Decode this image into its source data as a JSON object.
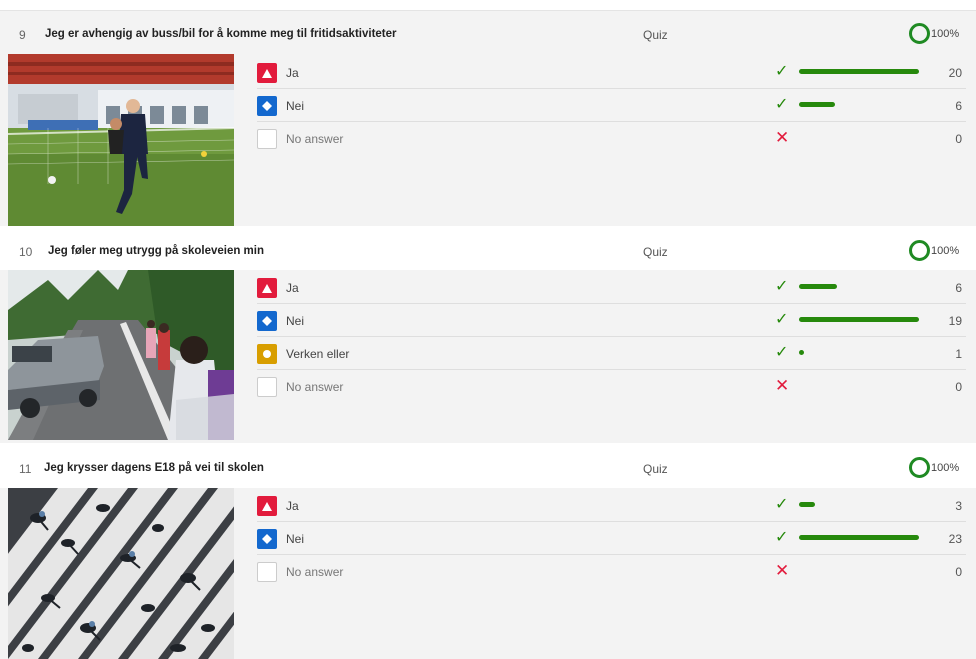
{
  "questions": [
    {
      "number": "9",
      "title": "Jeg er avhengig av buss/bil for å komme meg til fritidsaktiviteter",
      "type": "Quiz",
      "percent": "100%",
      "max": 20,
      "answers": [
        {
          "label": "Ja",
          "shape": "triangle",
          "color": "#e21b3c",
          "correct": true,
          "count": "20",
          "value": 20
        },
        {
          "label": "Nei",
          "shape": "diamond",
          "color": "#1368ce",
          "correct": true,
          "count": "6",
          "value": 6
        },
        {
          "label": "No answer",
          "shape": "none",
          "color": "#ffffff",
          "correct": false,
          "count": "0",
          "value": 0
        }
      ]
    },
    {
      "number": "10",
      "title": "Jeg føler meg utrygg på skoleveien min",
      "type": "Quiz",
      "percent": "100%",
      "max": 19,
      "answers": [
        {
          "label": "Ja",
          "shape": "triangle",
          "color": "#e21b3c",
          "correct": true,
          "count": "6",
          "value": 6
        },
        {
          "label": "Nei",
          "shape": "diamond",
          "color": "#1368ce",
          "correct": true,
          "count": "19",
          "value": 19
        },
        {
          "label": "Verken eller",
          "shape": "circle",
          "color": "#d89e00",
          "correct": true,
          "count": "1",
          "value": 1
        },
        {
          "label": "No answer",
          "shape": "none",
          "color": "#ffffff",
          "correct": false,
          "count": "0",
          "value": 0
        }
      ]
    },
    {
      "number": "11",
      "title": "Jeg krysser dagens E18 på vei til skolen",
      "type": "Quiz",
      "percent": "100%",
      "max": 23,
      "answers": [
        {
          "label": "Ja",
          "shape": "triangle",
          "color": "#e21b3c",
          "correct": true,
          "count": "3",
          "value": 3
        },
        {
          "label": "Nei",
          "shape": "diamond",
          "color": "#1368ce",
          "correct": true,
          "count": "23",
          "value": 23
        },
        {
          "label": "No answer",
          "shape": "none",
          "color": "#ffffff",
          "correct": false,
          "count": "0",
          "value": 0
        }
      ]
    }
  ],
  "icons": {
    "correct": "checkmark-icon",
    "incorrect": "cross-icon",
    "progress": "ring-icon"
  },
  "colors": {
    "accent_green": "#26890c",
    "ring_green": "#1f8a23",
    "panel_bg": "#f3f3f3"
  }
}
